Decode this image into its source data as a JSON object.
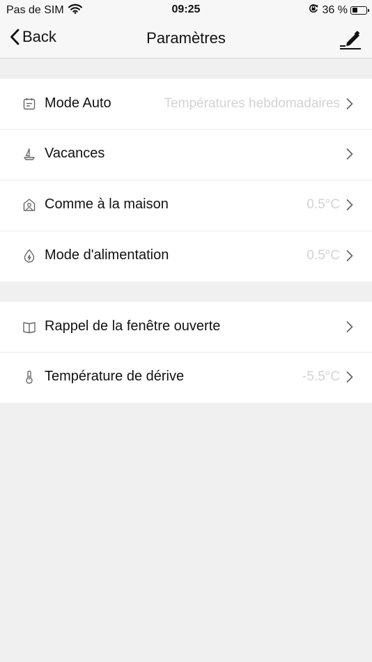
{
  "status_bar": {
    "carrier": "Pas de SIM",
    "time": "09:25",
    "battery": "36 %"
  },
  "nav": {
    "back_label": "Back",
    "title": "Paramètres"
  },
  "groups": [
    {
      "rows": [
        {
          "icon": "calendar-icon",
          "label": "Mode Auto",
          "value": "Températures hebdomadaires"
        },
        {
          "icon": "boat-icon",
          "label": "Vacances",
          "value": ""
        },
        {
          "icon": "home-person-icon",
          "label": "Comme à la maison",
          "value": "0.5°C"
        },
        {
          "icon": "power-drop-icon",
          "label": "Mode d'alimentation",
          "value": "0.5°C"
        }
      ]
    },
    {
      "rows": [
        {
          "icon": "window-icon",
          "label": "Rappel de la fenêtre ouverte",
          "value": ""
        },
        {
          "icon": "thermometer-icon",
          "label": "Température de dérive",
          "value": "-5.5°C"
        }
      ]
    }
  ],
  "colors": {
    "background": "#f0f0f0",
    "row_background": "#ffffff",
    "value_text": "#d3d3d3",
    "icon_stroke": "#666666"
  }
}
